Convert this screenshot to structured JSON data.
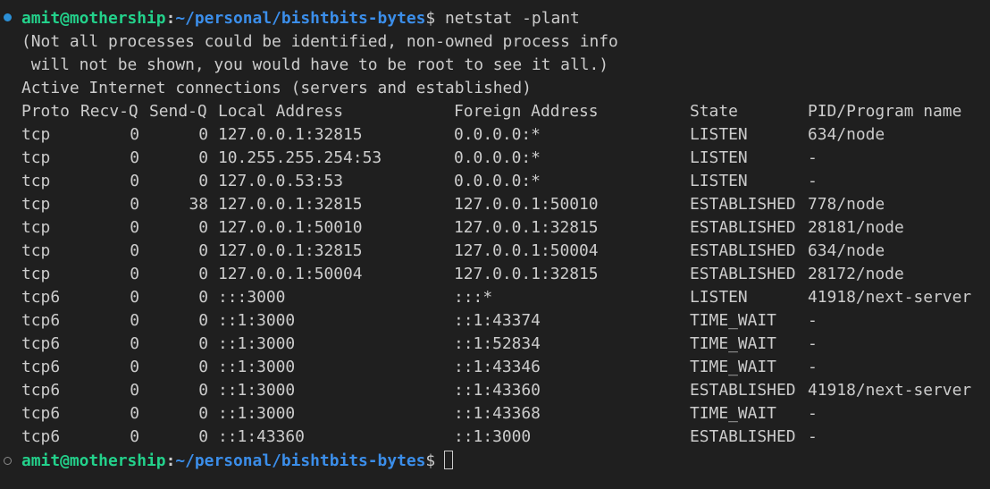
{
  "prompt": {
    "user_host": "amit@mothership",
    "separator": ":",
    "path": "~/personal/bishtbits-bytes",
    "dollar": "$"
  },
  "command": "netstat -plant",
  "notice": [
    "(Not all processes could be identified, non-owned process info",
    " will not be shown, you would have to be root to see it all.)"
  ],
  "section_title": "Active Internet connections (servers and established)",
  "table": {
    "headers": {
      "proto": "Proto",
      "recv": "Recv-Q",
      "send": "Send-Q",
      "local": "Local Address",
      "foreign": "Foreign Address",
      "state": "State",
      "pid": "PID/Program name"
    },
    "rows": [
      {
        "proto": "tcp",
        "recv": "0",
        "send": "0",
        "local": "127.0.0.1:32815",
        "foreign": "0.0.0.0:*",
        "state": "LISTEN",
        "pid": "634/node"
      },
      {
        "proto": "tcp",
        "recv": "0",
        "send": "0",
        "local": "10.255.255.254:53",
        "foreign": "0.0.0.0:*",
        "state": "LISTEN",
        "pid": "-"
      },
      {
        "proto": "tcp",
        "recv": "0",
        "send": "0",
        "local": "127.0.0.53:53",
        "foreign": "0.0.0.0:*",
        "state": "LISTEN",
        "pid": "-"
      },
      {
        "proto": "tcp",
        "recv": "0",
        "send": "38",
        "local": "127.0.0.1:32815",
        "foreign": "127.0.0.1:50010",
        "state": "ESTABLISHED",
        "pid": "778/node"
      },
      {
        "proto": "tcp",
        "recv": "0",
        "send": "0",
        "local": "127.0.0.1:50010",
        "foreign": "127.0.0.1:32815",
        "state": "ESTABLISHED",
        "pid": "28181/node"
      },
      {
        "proto": "tcp",
        "recv": "0",
        "send": "0",
        "local": "127.0.0.1:32815",
        "foreign": "127.0.0.1:50004",
        "state": "ESTABLISHED",
        "pid": "634/node"
      },
      {
        "proto": "tcp",
        "recv": "0",
        "send": "0",
        "local": "127.0.0.1:50004",
        "foreign": "127.0.0.1:32815",
        "state": "ESTABLISHED",
        "pid": "28172/node"
      },
      {
        "proto": "tcp6",
        "recv": "0",
        "send": "0",
        "local": ":::3000",
        "foreign": ":::*",
        "state": "LISTEN",
        "pid": "41918/next-server"
      },
      {
        "proto": "tcp6",
        "recv": "0",
        "send": "0",
        "local": "::1:3000",
        "foreign": "::1:43374",
        "state": "TIME_WAIT",
        "pid": "-"
      },
      {
        "proto": "tcp6",
        "recv": "0",
        "send": "0",
        "local": "::1:3000",
        "foreign": "::1:52834",
        "state": "TIME_WAIT",
        "pid": "-"
      },
      {
        "proto": "tcp6",
        "recv": "0",
        "send": "0",
        "local": "::1:3000",
        "foreign": "::1:43346",
        "state": "TIME_WAIT",
        "pid": "-"
      },
      {
        "proto": "tcp6",
        "recv": "0",
        "send": "0",
        "local": "::1:3000",
        "foreign": "::1:43360",
        "state": "ESTABLISHED",
        "pid": "41918/next-server"
      },
      {
        "proto": "tcp6",
        "recv": "0",
        "send": "0",
        "local": "::1:3000",
        "foreign": "::1:43368",
        "state": "TIME_WAIT",
        "pid": "-"
      },
      {
        "proto": "tcp6",
        "recv": "0",
        "send": "0",
        "local": "::1:43360",
        "foreign": "::1:3000",
        "state": "ESTABLISHED",
        "pid": "-"
      }
    ]
  },
  "colors": {
    "background": "#1f1f1f",
    "text": "#cccccc",
    "user_host": "#23d18b",
    "path": "#3b8eea",
    "decoration_success": "#2b8fd6",
    "decoration_pending": "#8a8a8a"
  },
  "icons": {
    "command_complete": "filled-circle-decoration-icon",
    "command_pending": "hollow-circle-decoration-icon",
    "cursor": "block-cursor-icon"
  }
}
